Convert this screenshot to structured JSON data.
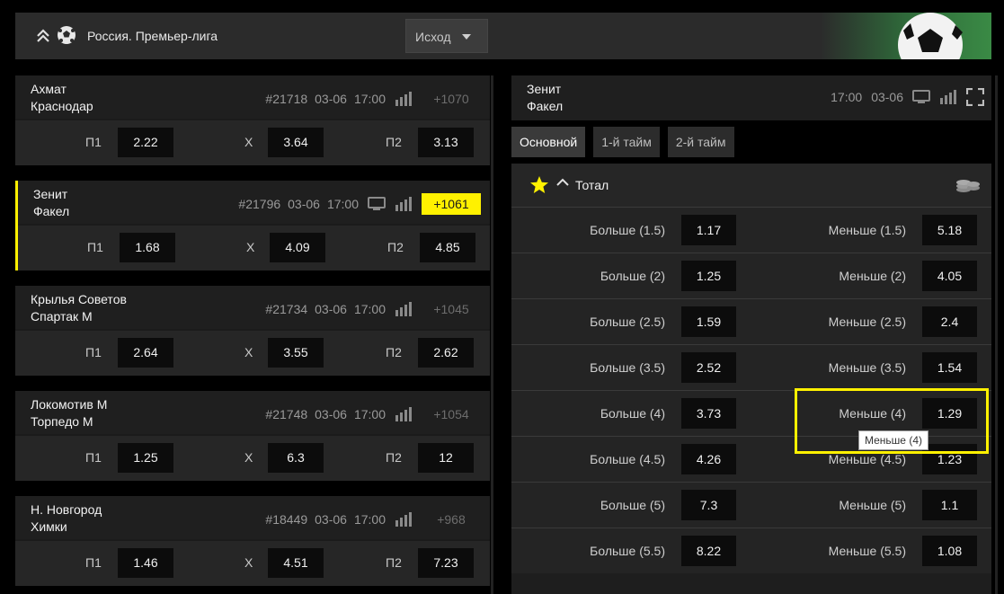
{
  "header": {
    "league": "Россия. Премьер-лига",
    "dropdown_value": "Исход"
  },
  "matches": [
    {
      "home": "Ахмат",
      "away": "Краснодар",
      "id": "#21718",
      "date": "03-06",
      "time": "17:00",
      "more": "+1070",
      "tv": false,
      "active": false,
      "p1_label": "П1",
      "x_label": "Х",
      "p2_label": "П2",
      "p1": "2.22",
      "x": "3.64",
      "p2": "3.13"
    },
    {
      "home": "Зенит",
      "away": "Факел",
      "id": "#21796",
      "date": "03-06",
      "time": "17:00",
      "more": "+1061",
      "tv": true,
      "active": true,
      "p1_label": "П1",
      "x_label": "Х",
      "p2_label": "П2",
      "p1": "1.68",
      "x": "4.09",
      "p2": "4.85"
    },
    {
      "home": "Крылья Советов",
      "away": "Спартак М",
      "id": "#21734",
      "date": "03-06",
      "time": "17:00",
      "more": "+1045",
      "tv": false,
      "active": false,
      "p1_label": "П1",
      "x_label": "Х",
      "p2_label": "П2",
      "p1": "2.64",
      "x": "3.55",
      "p2": "2.62"
    },
    {
      "home": "Локомотив М",
      "away": "Торпедо М",
      "id": "#21748",
      "date": "03-06",
      "time": "17:00",
      "more": "+1054",
      "tv": false,
      "active": false,
      "p1_label": "П1",
      "x_label": "Х",
      "p2_label": "П2",
      "p1": "1.25",
      "x": "6.3",
      "p2": "12"
    },
    {
      "home": "Н. Новгород",
      "away": "Химки",
      "id": "#18449",
      "date": "03-06",
      "time": "17:00",
      "more": "+968",
      "tv": false,
      "active": false,
      "p1_label": "П1",
      "x_label": "Х",
      "p2_label": "П2",
      "p1": "1.46",
      "x": "4.51",
      "p2": "7.23"
    }
  ],
  "detail": {
    "home": "Зенит",
    "away": "Факел",
    "time": "17:00",
    "date": "03-06",
    "tabs": [
      "Основной",
      "1-й тайм",
      "2-й тайм"
    ],
    "market_title": "Тотал",
    "rows": [
      {
        "over_label": "Больше (1.5)",
        "over": "1.17",
        "under_label": "Меньше (1.5)",
        "under": "5.18"
      },
      {
        "over_label": "Больше (2)",
        "over": "1.25",
        "under_label": "Меньше (2)",
        "under": "4.05"
      },
      {
        "over_label": "Больше (2.5)",
        "over": "1.59",
        "under_label": "Меньше (2.5)",
        "under": "2.4"
      },
      {
        "over_label": "Больше (3.5)",
        "over": "2.52",
        "under_label": "Меньше (3.5)",
        "under": "1.54"
      },
      {
        "over_label": "Больше (4)",
        "over": "3.73",
        "under_label": "Меньше (4)",
        "under": "1.29"
      },
      {
        "over_label": "Больше (4.5)",
        "over": "4.26",
        "under_label": "Меньше (4.5)",
        "under": "1.23"
      },
      {
        "over_label": "Больше (5)",
        "over": "7.3",
        "under_label": "Меньше (5)",
        "under": "1.1"
      },
      {
        "over_label": "Больше (5.5)",
        "over": "8.22",
        "under_label": "Меньше (5.5)",
        "under": "1.08"
      }
    ]
  },
  "tooltip": "Меньше (4)",
  "colors": {
    "accent": "#fff100",
    "background": "#000000",
    "panel": "#1f1f1f",
    "odd_box": "#0c0c0c"
  }
}
